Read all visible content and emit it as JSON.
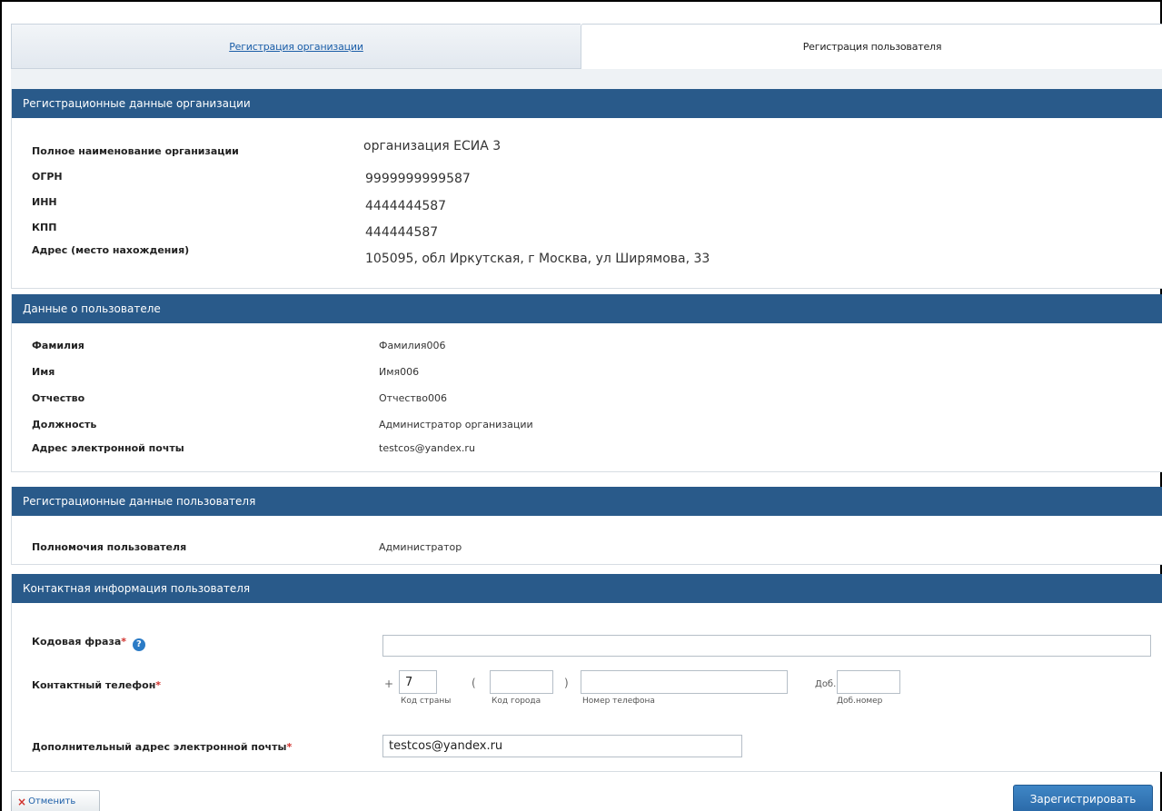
{
  "tabs": {
    "org_registration": "Регистрация организации",
    "user_registration": "Регистрация пользователя"
  },
  "org_section": {
    "title": "Регистрационные данные организации",
    "fields": [
      {
        "label": "Полное наименование организации",
        "value": "организация ЕСИА 3"
      },
      {
        "label": "ОГРН",
        "value": "9999999999587"
      },
      {
        "label": "ИНН",
        "value": "4444444587"
      },
      {
        "label": "КПП",
        "value": "444444587"
      },
      {
        "label": "Адрес (место нахождения)",
        "value": "105095, обл Иркутская, г Москва, ул Ширямова, 33"
      }
    ]
  },
  "user_section": {
    "title": "Данные о пользователе",
    "fields": [
      {
        "label": "Фамилия",
        "value": "Фамилия006"
      },
      {
        "label": "Имя",
        "value": "Имя006"
      },
      {
        "label": "Отчество",
        "value": "Отчество006"
      },
      {
        "label": "Должность",
        "value": "Администратор организации"
      },
      {
        "label": "Адрес электронной почты",
        "value": "testcos@yandex.ru"
      }
    ]
  },
  "user_reg_section": {
    "title": "Регистрационные данные пользователя",
    "fields": [
      {
        "label": "Полномочия пользователя",
        "value": "Администратор"
      }
    ]
  },
  "contact_section": {
    "title": "Контактная информация пользователя",
    "code_phrase": {
      "label": "Кодовая фраза",
      "required_mark": "*",
      "help": "?",
      "value": ""
    },
    "phone": {
      "label": "Контактный телефон",
      "required_mark": "*",
      "plus": "+",
      "country_code": "7",
      "city_code": "",
      "number": "",
      "extension": "",
      "open_paren": "(",
      "close_paren": ")",
      "ext_label": "Доб.",
      "country_code_hint": "Код страны",
      "city_code_hint": "Код города",
      "number_hint": "Номер телефона",
      "ext_hint": "Доб.номер"
    },
    "extra_email": {
      "label": "Дополнительный адрес электронной почты",
      "required_mark": "*",
      "value": "testcos@yandex.ru"
    }
  },
  "actions": {
    "cancel_icon": "×",
    "cancel": "Отменить",
    "submit": "Зарегистрировать"
  }
}
